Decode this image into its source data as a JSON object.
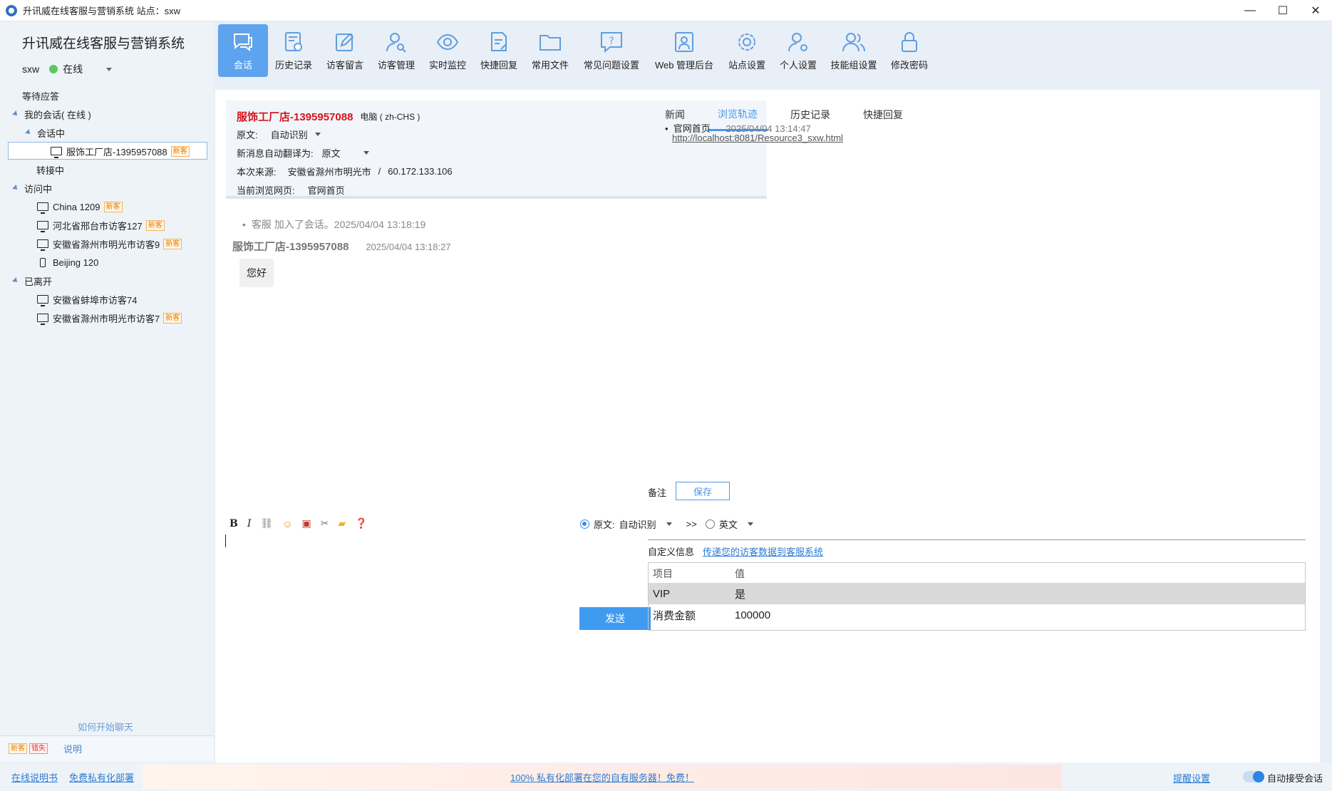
{
  "window": {
    "title": "升讯威在线客服与营销系统  站点：sxw",
    "min": "—",
    "max": "☐",
    "close": "✕"
  },
  "sidebar": {
    "brand": "升讯威在线客服与营销系统",
    "user": "sxw",
    "status": "在线",
    "tree": {
      "waiting": "等待应答",
      "my_sessions": "我的会话( 在线 )",
      "in_session": "会话中",
      "active_visitor": "服饰工厂店-1395957088",
      "transferring": "转接中",
      "visiting": "访问中",
      "visitors": [
        {
          "name": "China 1209",
          "tag": "新客",
          "device": "pc"
        },
        {
          "name": "河北省邢台市访客127",
          "tag": "新客",
          "device": "pc"
        },
        {
          "name": "安徽省滁州市明光市访客9",
          "tag": "新客",
          "device": "pc"
        },
        {
          "name": "Beijing 120",
          "tag": "",
          "device": "mobile"
        }
      ],
      "left_label": "已离开",
      "left_visitors": [
        {
          "name": "安徽省蚌埠市访客74",
          "tag": ""
        },
        {
          "name": "安徽省滁州市明光市访客7",
          "tag": "新客"
        }
      ]
    },
    "new_tag": "新客",
    "how_to_chat": "如何开始聊天",
    "legend": {
      "new": "新客",
      "missed": "错失",
      "explain": "说明"
    }
  },
  "toolbar": {
    "items": [
      "会话",
      "历史记录",
      "访客留言",
      "访客管理",
      "实时监控",
      "快捷回复",
      "常用文件",
      "常见问题设置",
      "Web 管理后台",
      "站点设置",
      "个人设置",
      "技能组设置",
      "修改密码"
    ]
  },
  "conversation": {
    "visitor_name": "服饰工厂店-1395957088",
    "device": "电脑 ( zh-CHS )",
    "original_label": "原文:",
    "original_value": "自动识别",
    "auto_translate_label": "新消息自动翻译为:",
    "auto_translate_value": "原文",
    "source_label": "本次来源:",
    "source_value": "安徽省滁州市明光市",
    "source_sep": "/",
    "source_ip": "60.172.133.106",
    "page_label": "当前浏览网页:",
    "page_value": "官网首页",
    "system_message": "客服 加入了会话。2025/04/04 13:18:19",
    "msg_sender": "服饰工厂店-1395957088",
    "msg_time": "2025/04/04 13:18:27",
    "msg_text": "您好"
  },
  "composer": {
    "lang_from_label": "原文:",
    "lang_from_value": "自动识别",
    "arrow": ">>",
    "lang_to_value": "英文",
    "send": "发送"
  },
  "right_panel": {
    "tabs": [
      "新闻",
      "浏览轨迹",
      "历史记录",
      "快捷回复"
    ],
    "active_tab": 1,
    "trail_title": "官网首页",
    "trail_time": "2025/04/04 13:14:47",
    "trail_url": "http://localhost:8081/Resource3_sxw.html",
    "note_label": "备注",
    "save": "保存",
    "custom_label": "自定义信息",
    "custom_link": "传递您的访客数据到客服系统",
    "table_headers": [
      "项目",
      "值"
    ],
    "table_rows": [
      {
        "key": "VIP",
        "value": "是"
      },
      {
        "key": "消费金额",
        "value": "100000"
      }
    ]
  },
  "footer": {
    "manual": "在线说明书",
    "private_deploy": "免费私有化部署",
    "banner": "100% 私有化部署在您的自有服务器！免费！",
    "remind": "提醒设置",
    "auto_accept": "自动接受会话"
  },
  "colors": {
    "accent": "#4a98ea",
    "active_tool": "#5ea3ee",
    "visitor_name": "#d6141a",
    "online": "#5ac85a"
  }
}
